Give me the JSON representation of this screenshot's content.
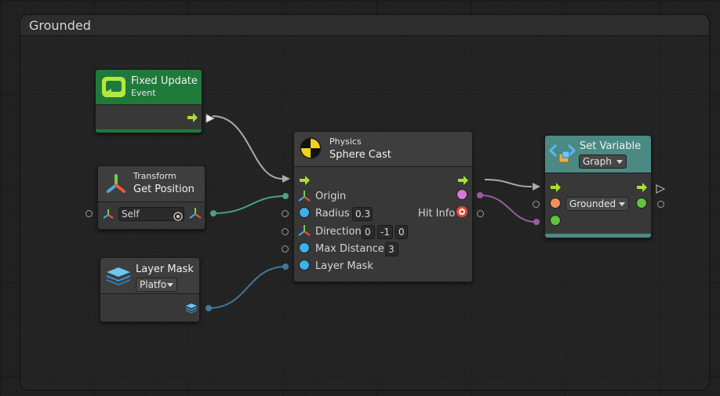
{
  "colors": {
    "event_green": "#1f7a3a",
    "variable_teal": "#4a8a82",
    "float_blue": "#3fb0e8",
    "vector_green": "#5ee0b0",
    "object_orange": "#f0915a",
    "bool_green": "#62c33e",
    "raycast_magenta": "#d27ad8",
    "layer_wire": "#4ea2d8",
    "flow_white": "#f0f0f0"
  },
  "group": {
    "title": "Grounded"
  },
  "nodes": {
    "fixed_update": {
      "title": "Fixed Update",
      "subtitle": "Event",
      "icon": "event-loop-icon"
    },
    "get_position": {
      "category": "Transform",
      "title": "Get Position",
      "input_value": "Self",
      "icon": "transform-icon"
    },
    "layer_mask": {
      "title": "Layer Mask",
      "dropdown_value": "Platfo",
      "icon": "layers-icon"
    },
    "sphere_cast": {
      "category": "Physics",
      "title": "Sphere Cast",
      "icon": "physics-icon",
      "ports": {
        "origin": "Origin",
        "radius": "Radius",
        "direction": "Direction",
        "max_distance": "Max Distance",
        "layer_mask": "Layer Mask",
        "hit_info": "Hit Info"
      },
      "values": {
        "radius": "0.3",
        "direction_x": "0",
        "direction_y": "-1",
        "direction_z": "0",
        "max_distance": "3"
      }
    },
    "set_variable": {
      "title": "Set Variable",
      "scope": "Graph",
      "variable": "Grounded",
      "icon": "variable-icon"
    }
  }
}
